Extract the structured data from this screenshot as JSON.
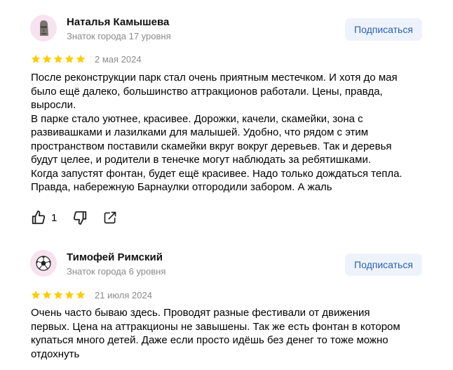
{
  "subscribe_label": "Подписаться",
  "reviews": [
    {
      "name": "Наталья Камышева",
      "level": "Знаток города 17 уровня",
      "rating": 5,
      "date": "2 мая 2024",
      "lines": [
        "После реконструкции парк стал очень приятным местечком. И хотя до мая",
        "было ещё далеко, большинство аттракционов работали. Цены, правда,",
        "выросли.",
        "В парке стало уютнее, красивее. Дорожки, качели, скамейки, зона с",
        "развивашками и лазилками для малышей. Удобно, что рядом с этим",
        "пространством поставили скамейки вкруг вокруг деревьев. Так и деревья",
        "будут целее, и родители в тенечке могут наблюдать за ребятишками.",
        "Когда запустят фонтан, будет ещё красивее. Надо только дождаться тепла.",
        "Правда, набережную Барнаулки отгородили забором. А жаль"
      ],
      "likes": "1"
    },
    {
      "name": "Тимофей Римский",
      "level": "Знаток города 6 уровня",
      "rating": 5,
      "date": "21 июля 2024",
      "lines": [
        "Очень часто бываю здесь. Проводят разные фестивали от движения",
        "первых. Цена на аттракционы не завышены. Так же есть фонтан в котором",
        "купаться много детей. Даже если просто идёшь без денег то тоже можно",
        "отдохнуть"
      ]
    }
  ],
  "colors": {
    "star": "#ffcc00",
    "subscribe_bg": "#eef3fb",
    "subscribe_text": "#2a5fb8",
    "muted": "#8a8a8a"
  },
  "icons": [
    "moai-avatar-icon",
    "soccer-ball-avatar-icon",
    "star-icon",
    "thumbs-up-icon",
    "thumbs-down-icon",
    "share-icon"
  ]
}
